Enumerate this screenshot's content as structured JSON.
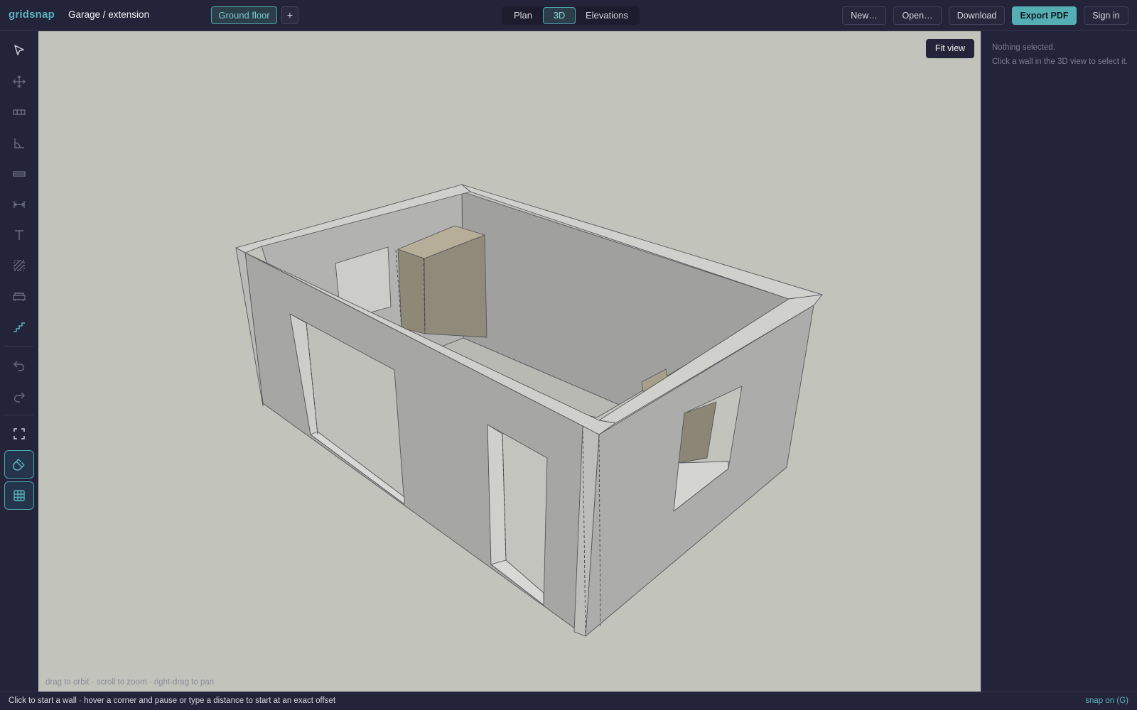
{
  "app": {
    "brand": "gridsnap",
    "project_title": "Garage / extension"
  },
  "floors": {
    "active": "Ground floor",
    "add_label": "+"
  },
  "views": {
    "plan": "Plan",
    "three_d": "3D",
    "elevations": "Elevations",
    "active": "3D"
  },
  "toolbar": {
    "new_label": "New…",
    "open_label": "Open…",
    "download_label": "Download",
    "export_label": "Export PDF",
    "signin_label": "Sign in"
  },
  "tools": [
    {
      "icon": "select-arrow-icon"
    },
    {
      "icon": "move-icon"
    },
    {
      "icon": "wall-icon"
    },
    {
      "icon": "angle-icon"
    },
    {
      "icon": "window-icon"
    },
    {
      "icon": "dimension-icon"
    },
    {
      "icon": "text-icon"
    },
    {
      "icon": "hatch-icon"
    },
    {
      "icon": "sofa-icon"
    },
    {
      "icon": "stairs-icon"
    },
    {
      "icon": "undo-icon"
    },
    {
      "icon": "redo-icon"
    },
    {
      "icon": "fullscreen-icon"
    },
    {
      "icon": "snap-magnet-icon",
      "active": true
    },
    {
      "icon": "grid-icon",
      "active": true
    }
  ],
  "viewport": {
    "fit_label": "Fit view",
    "hint": "drag to orbit · scroll to zoom · right-drag to pan"
  },
  "inspector": {
    "title": "Nothing selected.",
    "help": "Click a wall in the 3D view to select it."
  },
  "status": {
    "message": "Click to start a wall · hover a corner and pause or type a distance to start at an exact offset",
    "snap": "snap on (G)"
  },
  "colors": {
    "accent": "#56aeb5",
    "chrome": "#23233a",
    "canvas": "#c2c3bb"
  }
}
